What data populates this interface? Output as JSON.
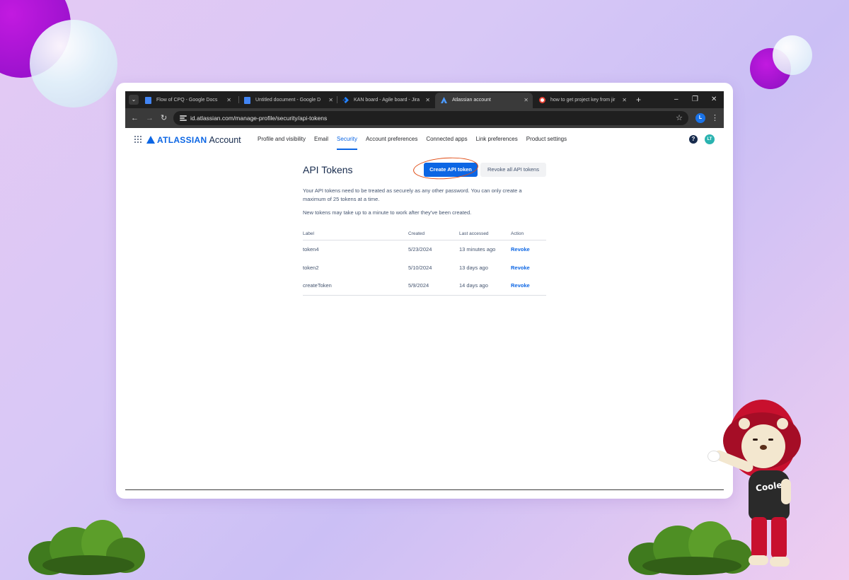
{
  "browser": {
    "tabs": [
      {
        "title": "Flow of CPQ - Google Docs",
        "favicon": "google-docs-icon",
        "active": false
      },
      {
        "title": "Untitled document - Google D",
        "favicon": "google-docs-icon",
        "active": false
      },
      {
        "title": "KAN board - Agile board - Jira",
        "favicon": "jira-icon",
        "active": false
      },
      {
        "title": "Atlassian account",
        "favicon": "atlassian-icon",
        "active": true
      },
      {
        "title": "how to get project key from jir",
        "favicon": "google-icon",
        "active": false
      }
    ],
    "tab_close": "✕",
    "new_tab": "+",
    "window_controls": {
      "minimize": "–",
      "restore": "❐",
      "close": "✕"
    },
    "back": "←",
    "forward": "→",
    "reload": "↻",
    "url": "id.atlassian.com/manage-profile/security/api-tokens",
    "bookmark": "☆",
    "profile_initial": "L",
    "menu": "⋮"
  },
  "header": {
    "logo_word": "ATLASSIAN",
    "logo_sub": "Account",
    "nav": [
      {
        "label": "Profile and visibility",
        "active": false
      },
      {
        "label": "Email",
        "active": false
      },
      {
        "label": "Security",
        "active": true
      },
      {
        "label": "Account preferences",
        "active": false
      },
      {
        "label": "Connected apps",
        "active": false
      },
      {
        "label": "Link preferences",
        "active": false
      },
      {
        "label": "Product settings",
        "active": false
      }
    ],
    "help": "?",
    "user_initials": "LT"
  },
  "main": {
    "title": "API Tokens",
    "create_button": "Create API token",
    "revoke_all_button": "Revoke all API tokens",
    "description_1": "Your API tokens need to be treated as securely as any other password. You can only create a maximum of 25 tokens at a time.",
    "description_2": "New tokens may take up to a minute to work after they've been created.",
    "table": {
      "columns": [
        "Label",
        "Created",
        "Last accessed",
        "Action"
      ],
      "rows": [
        {
          "label": "token4",
          "created": "5/23/2024",
          "last_accessed": "13 minutes ago",
          "action": "Revoke"
        },
        {
          "label": "token2",
          "created": "5/10/2024",
          "last_accessed": "13 days ago",
          "action": "Revoke"
        },
        {
          "label": "createToken",
          "created": "5/9/2024",
          "last_accessed": "14 days ago",
          "action": "Revoke"
        }
      ]
    }
  },
  "mascot": {
    "shirt_text": "Coole"
  },
  "colors": {
    "accent": "#0c66e4",
    "highlight": "#e04a12",
    "text": "#172b4d",
    "subtle_text": "#44546f",
    "browser_dark": "#1f1f1f"
  }
}
